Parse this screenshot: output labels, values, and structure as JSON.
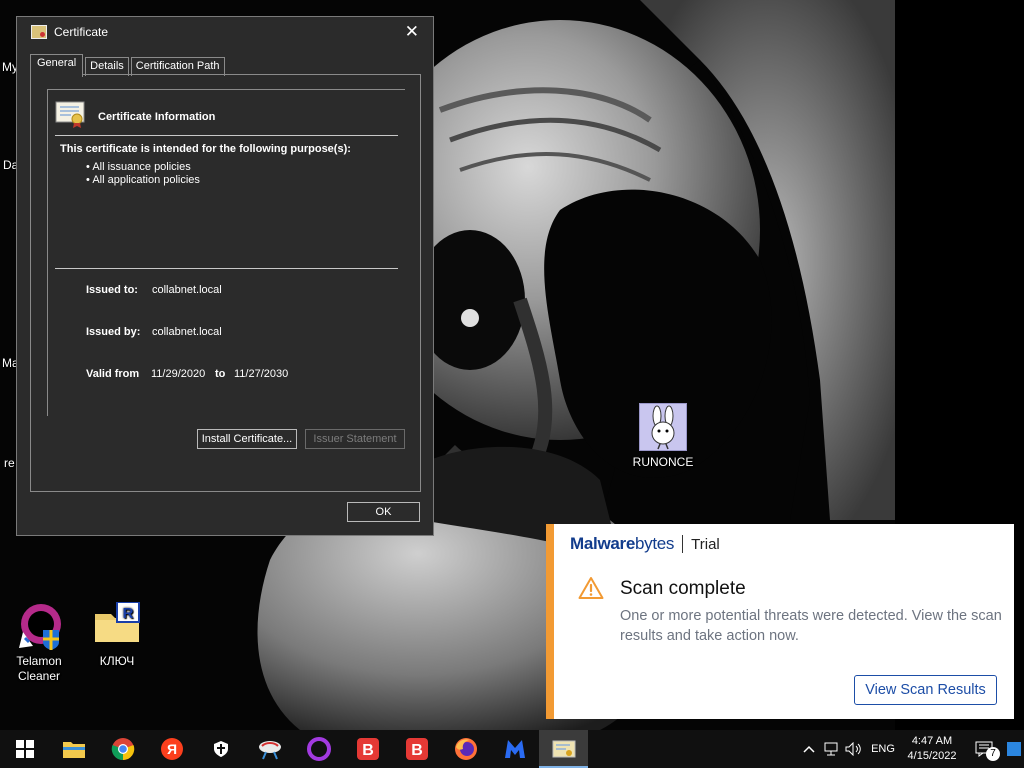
{
  "desktop": {
    "edge_labels": [
      "My",
      "Da",
      "Ma",
      "re"
    ],
    "icons": [
      {
        "label_line1": "Telamon",
        "label_line2": "Cleaner",
        "icon": "telamon-cleaner-icon"
      },
      {
        "label_line1": "КЛЮЧ",
        "icon": "folder-icon"
      },
      {
        "label_line1": "RUNONCE",
        "icon": "bunny-app-icon"
      }
    ]
  },
  "certificate": {
    "title": "Certificate",
    "close_glyph": "✕",
    "tabs": [
      "General",
      "Details",
      "Certification Path"
    ],
    "info_title": "Certificate Information",
    "purpose_heading": "This certificate is intended for the following purpose(s):",
    "purposes": [
      "All issuance policies",
      "All application policies"
    ],
    "issued_to_label": "Issued to:",
    "issued_to": "collabnet.local",
    "issued_by_label": "Issued by:",
    "issued_by": "collabnet.local",
    "valid_from_label": "Valid from",
    "valid_from": "11/29/2020",
    "to_label": "to",
    "valid_to": "11/27/2030",
    "install_button": "Install Certificate...",
    "issuer_button": "Issuer Statement",
    "ok_button": "OK"
  },
  "toast": {
    "brand_malware": "Malware",
    "brand_bytes": "bytes",
    "edition": "Trial",
    "heading": "Scan complete",
    "body": "One or more potential threats were detected. View the scan results and take action now.",
    "button": "View Scan Results",
    "accent_color": "#f29a33",
    "brand_color": "#123c8c"
  },
  "taskbar": {
    "apps": [
      "start-icon",
      "file-explorer-icon",
      "chrome-icon",
      "yandex-icon",
      "shield-app-icon",
      "network-app-icon",
      "opera-icon",
      "b-app-icon",
      "b-app-icon-2",
      "firefox-icon",
      "malwarebytes-icon",
      "certificate-app-icon"
    ],
    "language": "ENG",
    "time": "4:47 AM",
    "date": "4/15/2022",
    "notification_count": "7"
  }
}
